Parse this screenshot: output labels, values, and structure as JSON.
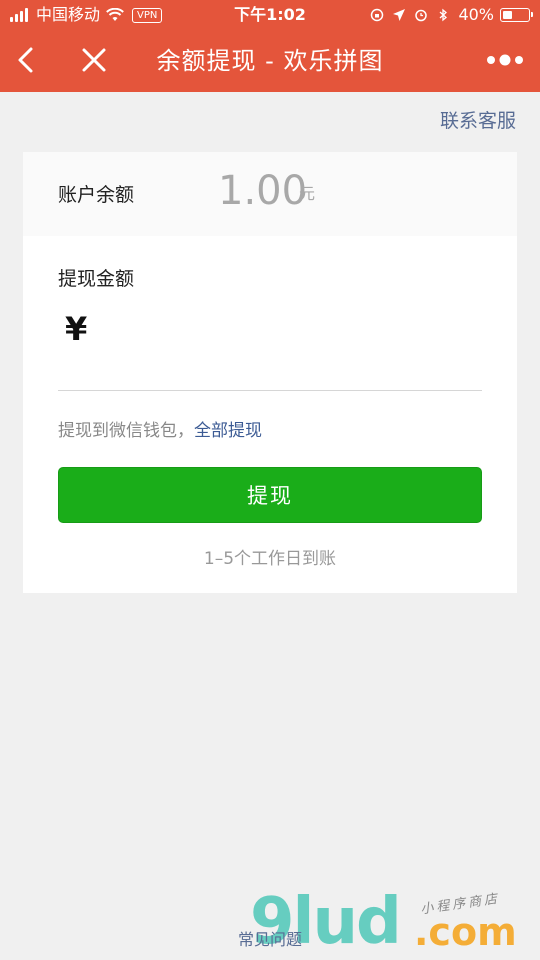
{
  "status_bar": {
    "carrier": "中国移动",
    "vpn": "VPN",
    "time": "下午1:02",
    "battery": "40%",
    "battery_level": 0.4
  },
  "nav": {
    "title": "余额提现 - 欢乐拼图",
    "icons": [
      "back-arrow-icon",
      "close-icon",
      "more-dots-icon"
    ]
  },
  "support_link": "联系客服",
  "balance": {
    "label": "账户余额",
    "value": "1.00",
    "unit": "元"
  },
  "withdraw": {
    "label": "提现金额",
    "currency": "¥",
    "amount": "",
    "hint": "提现到微信钱包，",
    "withdraw_all": "全部提现",
    "button": "提现",
    "arrival": "1–5个工作日到账"
  },
  "footer": {
    "faq": "常见问题"
  },
  "watermark": {
    "logo": "9lud",
    "dot_com": ".com",
    "tagline": "小程序商店"
  },
  "colors": {
    "header": "#e4553b",
    "button": "#1aad19",
    "link": "#586c94"
  }
}
